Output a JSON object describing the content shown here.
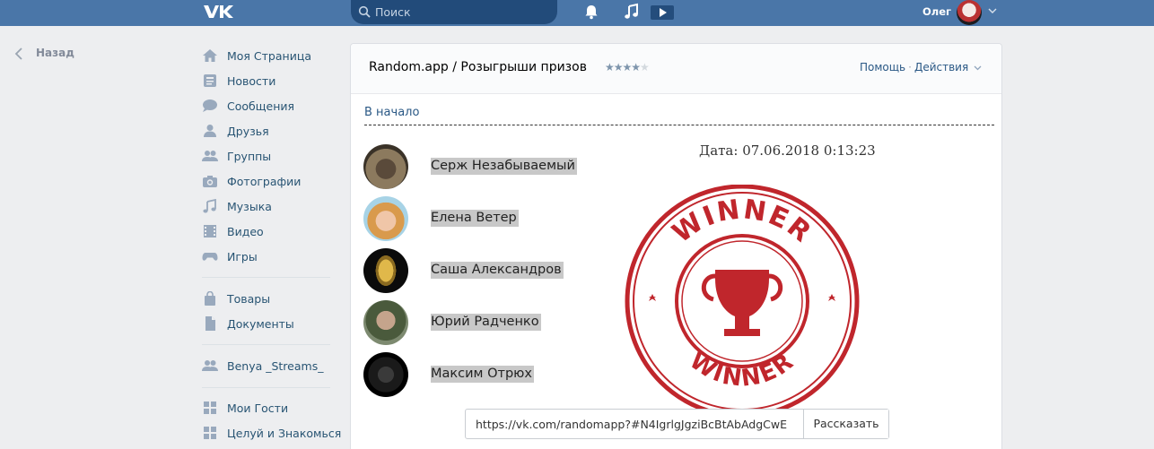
{
  "header": {
    "logo": "vk-logo",
    "search": {
      "placeholder": "Поиск"
    },
    "icons": [
      "bell-icon",
      "music-note-icon",
      "play-icon"
    ],
    "user_name": "Олег"
  },
  "back": {
    "label": "Назад"
  },
  "menu": {
    "items": [
      {
        "label": "Моя Страница",
        "icon": "home-icon"
      },
      {
        "label": "Новости",
        "icon": "news-icon"
      },
      {
        "label": "Сообщения",
        "icon": "messages-icon"
      },
      {
        "label": "Друзья",
        "icon": "friends-icon"
      },
      {
        "label": "Группы",
        "icon": "groups-icon"
      },
      {
        "label": "Фотографии",
        "icon": "camera-icon"
      },
      {
        "label": "Музыка",
        "icon": "music-icon"
      },
      {
        "label": "Видео",
        "icon": "video-icon"
      },
      {
        "label": "Игры",
        "icon": "gamepad-icon"
      },
      {
        "label": "Товары",
        "icon": "bag-icon"
      },
      {
        "label": "Документы",
        "icon": "document-icon"
      },
      {
        "label": "Benya _Streams_",
        "icon": "group-icon"
      },
      {
        "label": "Мои Гости",
        "icon": "app-grid-icon"
      },
      {
        "label": "Целуй и Знакомься",
        "icon": "app-grid-icon"
      }
    ]
  },
  "app": {
    "title": "Random.app / Розыгрыши призов",
    "rating": 4,
    "rating_max": 5,
    "help": "Помощь",
    "actions": "Действия",
    "home_link": "В начало",
    "date": "Дата: 07.06.2018 0:13:23",
    "stamp_text": "WINNER",
    "winners": [
      {
        "name": "Серж Незабываемый "
      },
      {
        "name": "Елена Ветер "
      },
      {
        "name": "Саша Александров"
      },
      {
        "name": "Юрий Радченко "
      },
      {
        "name": "Максим Отрюх"
      }
    ],
    "share_url": "https://vk.com/randomapp?#N4IgrlgJgziBcBtAbAdgCwE",
    "share_button": "Рассказать"
  },
  "colors": {
    "header_bg": "#4a76a8",
    "link": "#2a5885",
    "stamp_red": "#c0262c"
  }
}
